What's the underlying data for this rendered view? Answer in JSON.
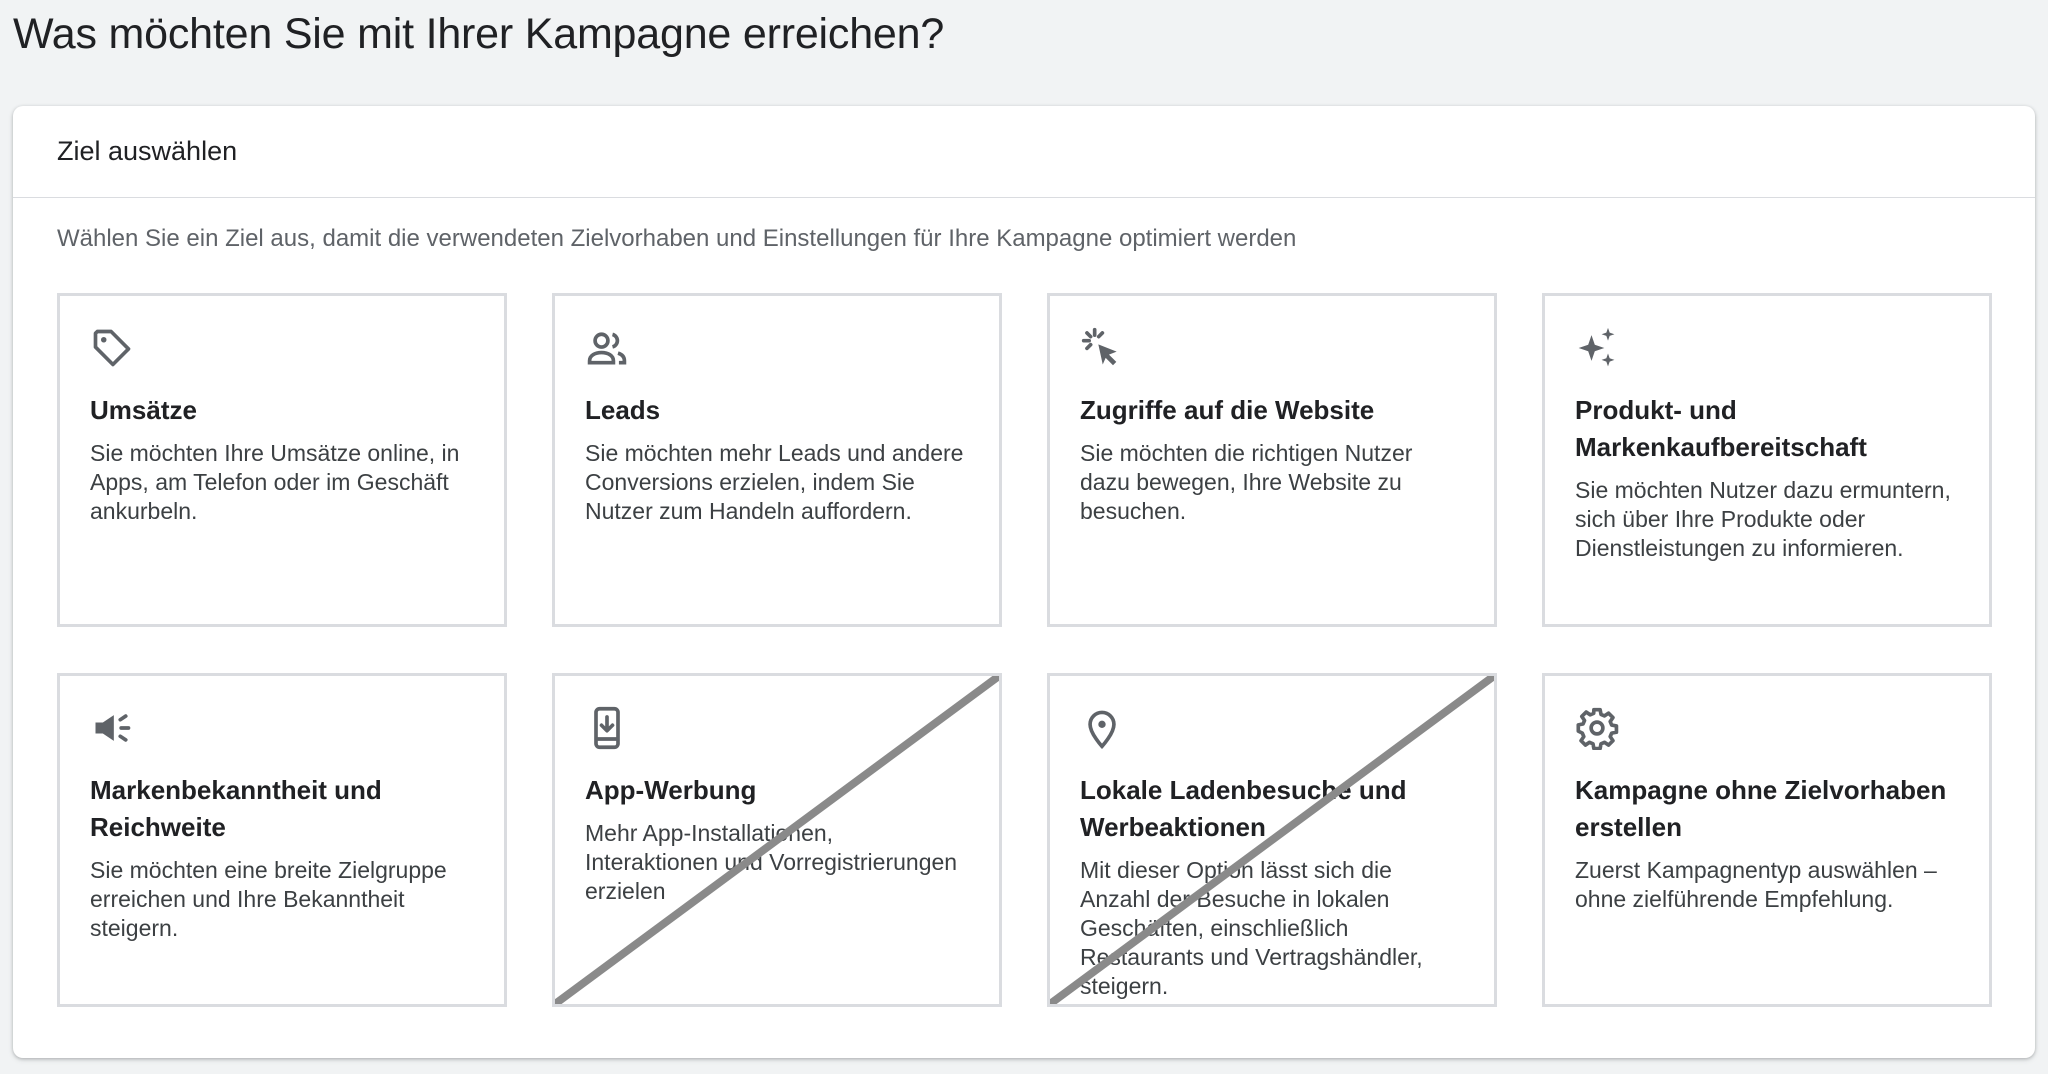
{
  "page": {
    "title": "Was möchten Sie mit Ihrer Kampagne erreichen?"
  },
  "panel": {
    "header": "Ziel auswählen",
    "description": "Wählen Sie ein Ziel aus, damit die verwendeten Zielvorhaben und Einstellungen für Ihre Kampagne optimiert werden"
  },
  "goals": [
    {
      "icon": "tag-icon",
      "title": "Umsätze",
      "text": "Sie möchten Ihre Umsätze online, in Apps, am Telefon oder im Geschäft ankurbeln.",
      "crossed_out": false
    },
    {
      "icon": "people-icon",
      "title": "Leads",
      "text": "Sie möchten mehr Leads und andere Conversions erzielen, indem Sie Nutzer zum Handeln auffordern.",
      "crossed_out": false
    },
    {
      "icon": "cursor-click-icon",
      "title": "Zugriffe auf die Website",
      "text": "Sie möchten die richtigen Nutzer dazu bewegen, Ihre Website zu besuchen.",
      "crossed_out": false
    },
    {
      "icon": "sparkle-icon",
      "title": "Produkt- und Markenkaufbereitschaft",
      "text": "Sie möchten Nutzer dazu ermuntern, sich über Ihre Produkte oder Dienstleistungen zu informieren.",
      "crossed_out": false
    },
    {
      "icon": "megaphone-icon",
      "title": "Markenbekanntheit und Reichweite",
      "text": "Sie möchten eine breite Zielgruppe erreichen und Ihre Bekanntheit steigern.",
      "crossed_out": false
    },
    {
      "icon": "phone-download-icon",
      "title": "App-Werbung",
      "text": "Mehr App-Installationen, Interaktionen und Vorregistrierungen erzielen",
      "crossed_out": true
    },
    {
      "icon": "location-pin-icon",
      "title": "Lokale Ladenbesuche und Werbeaktionen",
      "text": "Mit dieser Option lässt sich die Anzahl der Besuche in lokalen Geschäften, einschließlich Restaurants und Vertragshändler, steigern.",
      "crossed_out": true
    },
    {
      "icon": "gear-icon",
      "title": "Kampagne ohne Zielvorhaben erstellen",
      "text": "Zuerst Kampagnentyp auswählen – ohne zielführende Empfehlung.",
      "crossed_out": false
    }
  ],
  "colors": {
    "background": "#f1f3f4",
    "icon": "#5f6368",
    "strike": "#8a8a8a"
  }
}
